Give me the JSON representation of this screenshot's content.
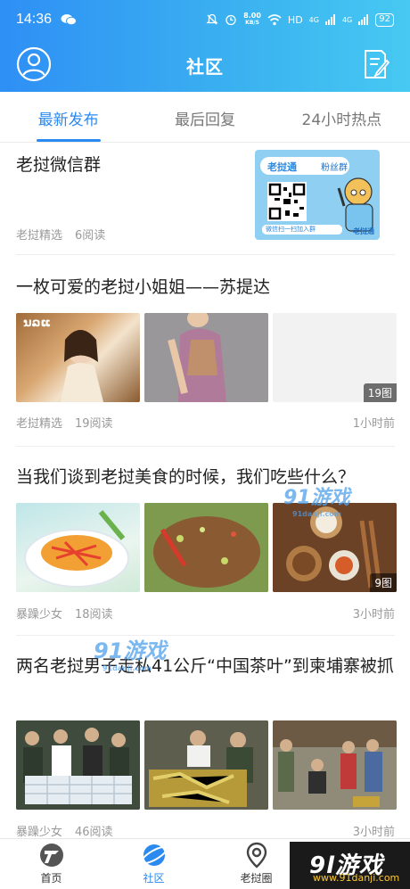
{
  "status_bar": {
    "time": "14:36",
    "network_speed": "8.00",
    "network_unit": "KB/S",
    "hd": "HD",
    "signal_1": "4G",
    "signal_2": "4G",
    "battery": "92"
  },
  "header": {
    "title": "社区"
  },
  "tabs": [
    {
      "label": "最新发布",
      "active": true
    },
    {
      "label": "最后回复",
      "active": false
    },
    {
      "label": "24小时热点",
      "active": false
    }
  ],
  "posts": [
    {
      "title": "老挝微信群",
      "author": "老挝精选",
      "reads": "6阅读",
      "ad": {
        "brand": "老挝通",
        "tag": "粉丝群",
        "hint": "微信扫一扫加入群",
        "corner": "老挝通"
      }
    },
    {
      "title": "一枚可爱的老挝小姐姐——苏提达",
      "author": "老挝精选",
      "reads": "19阅读",
      "time": "1小时前",
      "image_count": "19图",
      "image_caption": "ນລແ"
    },
    {
      "title": "当我们谈到老挝美食的时候，我们吃些什么？",
      "author": "暴躁少女",
      "reads": "18阅读",
      "time": "3小时前",
      "image_count": "9图"
    },
    {
      "title": "两名老挝男子走私41公斤“中国茶叶”到柬埔寨被抓",
      "author": "暴躁少女",
      "reads": "46阅读",
      "time": "3小时前"
    }
  ],
  "watermark": {
    "text": "91游戏",
    "sub": "91danji.com"
  },
  "bottom_nav": [
    {
      "label": "首页",
      "icon": "home-logo-icon",
      "active": false
    },
    {
      "label": "社区",
      "icon": "planet-icon",
      "active": true
    },
    {
      "label": "老挝圈",
      "icon": "location-pin-icon",
      "active": false
    }
  ],
  "brand_corner": {
    "logo": "9l游戏",
    "url": "www.91danji.com"
  },
  "colors": {
    "header_start": "#2e8ff5",
    "header_end": "#46c9f2",
    "accent": "#2b8af0"
  }
}
